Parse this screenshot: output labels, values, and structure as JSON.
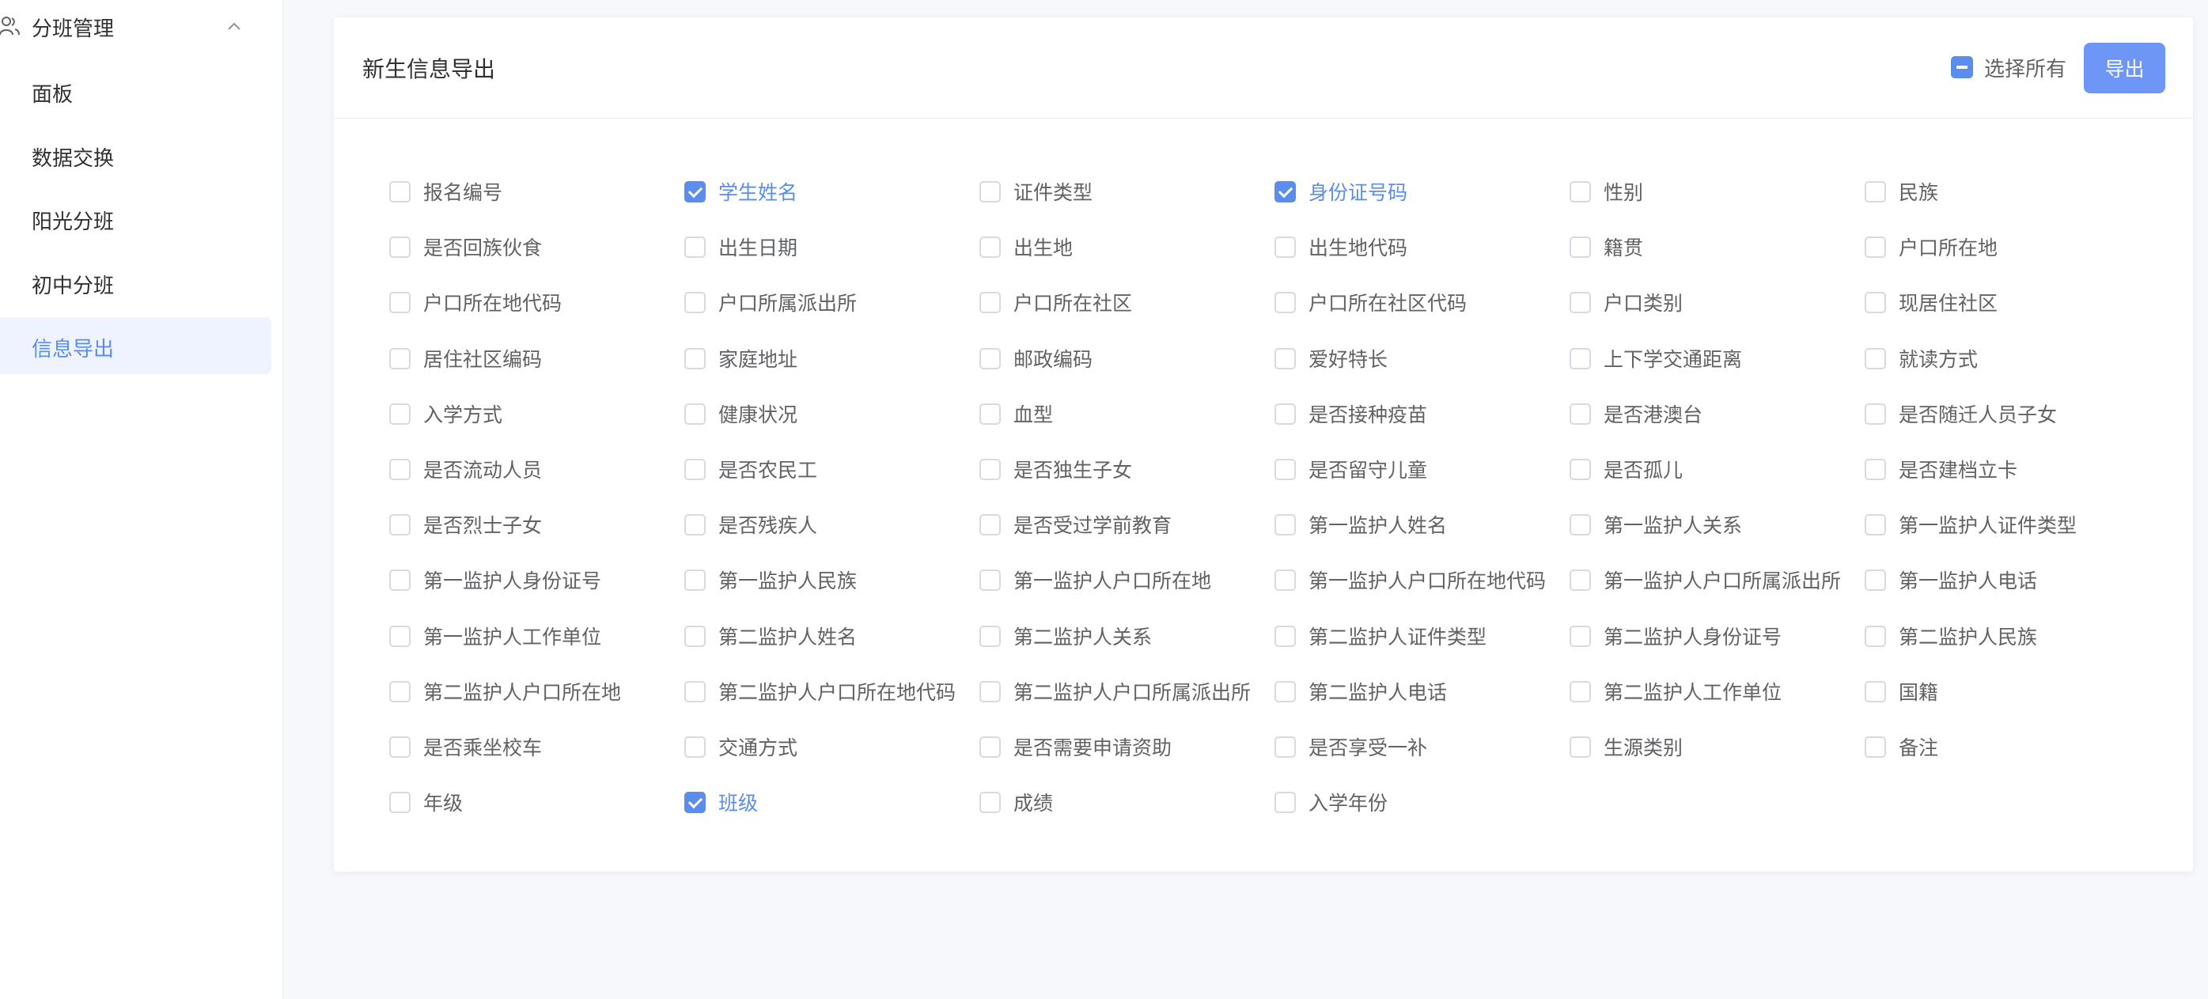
{
  "sidebar": {
    "group_label": "分班管理",
    "group_icon": "users-icon",
    "chevron_icon": "chevron-up-icon",
    "items": [
      {
        "label": "面板",
        "active": false
      },
      {
        "label": "数据交换",
        "active": false
      },
      {
        "label": "阳光分班",
        "active": false
      },
      {
        "label": "初中分班",
        "active": false
      },
      {
        "label": "信息导出",
        "active": true
      }
    ]
  },
  "card": {
    "title": "新生信息导出",
    "select_all_label": "选择所有",
    "select_all_state": "indeterminate",
    "export_label": "导出"
  },
  "fields": [
    {
      "label": "报名编号",
      "checked": false
    },
    {
      "label": "学生姓名",
      "checked": true
    },
    {
      "label": "证件类型",
      "checked": false
    },
    {
      "label": "身份证号码",
      "checked": true
    },
    {
      "label": "性别",
      "checked": false
    },
    {
      "label": "民族",
      "checked": false
    },
    {
      "label": "是否回族伙食",
      "checked": false
    },
    {
      "label": "出生日期",
      "checked": false
    },
    {
      "label": "出生地",
      "checked": false
    },
    {
      "label": "出生地代码",
      "checked": false
    },
    {
      "label": "籍贯",
      "checked": false
    },
    {
      "label": "户口所在地",
      "checked": false
    },
    {
      "label": "户口所在地代码",
      "checked": false
    },
    {
      "label": "户口所属派出所",
      "checked": false
    },
    {
      "label": "户口所在社区",
      "checked": false
    },
    {
      "label": "户口所在社区代码",
      "checked": false
    },
    {
      "label": "户口类别",
      "checked": false
    },
    {
      "label": "现居住社区",
      "checked": false
    },
    {
      "label": "居住社区编码",
      "checked": false
    },
    {
      "label": "家庭地址",
      "checked": false
    },
    {
      "label": "邮政编码",
      "checked": false
    },
    {
      "label": "爱好特长",
      "checked": false
    },
    {
      "label": "上下学交通距离",
      "checked": false
    },
    {
      "label": "就读方式",
      "checked": false
    },
    {
      "label": "入学方式",
      "checked": false
    },
    {
      "label": "健康状况",
      "checked": false
    },
    {
      "label": "血型",
      "checked": false
    },
    {
      "label": "是否接种疫苗",
      "checked": false
    },
    {
      "label": "是否港澳台",
      "checked": false
    },
    {
      "label": "是否随迁人员子女",
      "checked": false
    },
    {
      "label": "是否流动人员",
      "checked": false
    },
    {
      "label": "是否农民工",
      "checked": false
    },
    {
      "label": "是否独生子女",
      "checked": false
    },
    {
      "label": "是否留守儿童",
      "checked": false
    },
    {
      "label": "是否孤儿",
      "checked": false
    },
    {
      "label": "是否建档立卡",
      "checked": false
    },
    {
      "label": "是否烈士子女",
      "checked": false
    },
    {
      "label": "是否残疾人",
      "checked": false
    },
    {
      "label": "是否受过学前教育",
      "checked": false
    },
    {
      "label": "第一监护人姓名",
      "checked": false
    },
    {
      "label": "第一监护人关系",
      "checked": false
    },
    {
      "label": "第一监护人证件类型",
      "checked": false
    },
    {
      "label": "第一监护人身份证号",
      "checked": false
    },
    {
      "label": "第一监护人民族",
      "checked": false
    },
    {
      "label": "第一监护人户口所在地",
      "checked": false
    },
    {
      "label": "第一监护人户口所在地代码",
      "checked": false
    },
    {
      "label": "第一监护人户口所属派出所",
      "checked": false
    },
    {
      "label": "第一监护人电话",
      "checked": false
    },
    {
      "label": "第一监护人工作单位",
      "checked": false
    },
    {
      "label": "第二监护人姓名",
      "checked": false
    },
    {
      "label": "第二监护人关系",
      "checked": false
    },
    {
      "label": "第二监护人证件类型",
      "checked": false
    },
    {
      "label": "第二监护人身份证号",
      "checked": false
    },
    {
      "label": "第二监护人民族",
      "checked": false
    },
    {
      "label": "第二监护人户口所在地",
      "checked": false
    },
    {
      "label": "第二监护人户口所在地代码",
      "checked": false
    },
    {
      "label": "第二监护人户口所属派出所",
      "checked": false
    },
    {
      "label": "第二监护人电话",
      "checked": false
    },
    {
      "label": "第二监护人工作单位",
      "checked": false
    },
    {
      "label": "国籍",
      "checked": false
    },
    {
      "label": "是否乘坐校车",
      "checked": false
    },
    {
      "label": "交通方式",
      "checked": false
    },
    {
      "label": "是否需要申请资助",
      "checked": false
    },
    {
      "label": "是否享受一补",
      "checked": false
    },
    {
      "label": "生源类别",
      "checked": false
    },
    {
      "label": "备注",
      "checked": false
    },
    {
      "label": "年级",
      "checked": false
    },
    {
      "label": "班级",
      "checked": true
    },
    {
      "label": "成绩",
      "checked": false
    },
    {
      "label": "入学年份",
      "checked": false
    }
  ],
  "colors": {
    "accent": "#5b8def",
    "button": "#6e96f7",
    "active_bg": "#eef3ff",
    "page_bg": "#f7f8fc"
  }
}
